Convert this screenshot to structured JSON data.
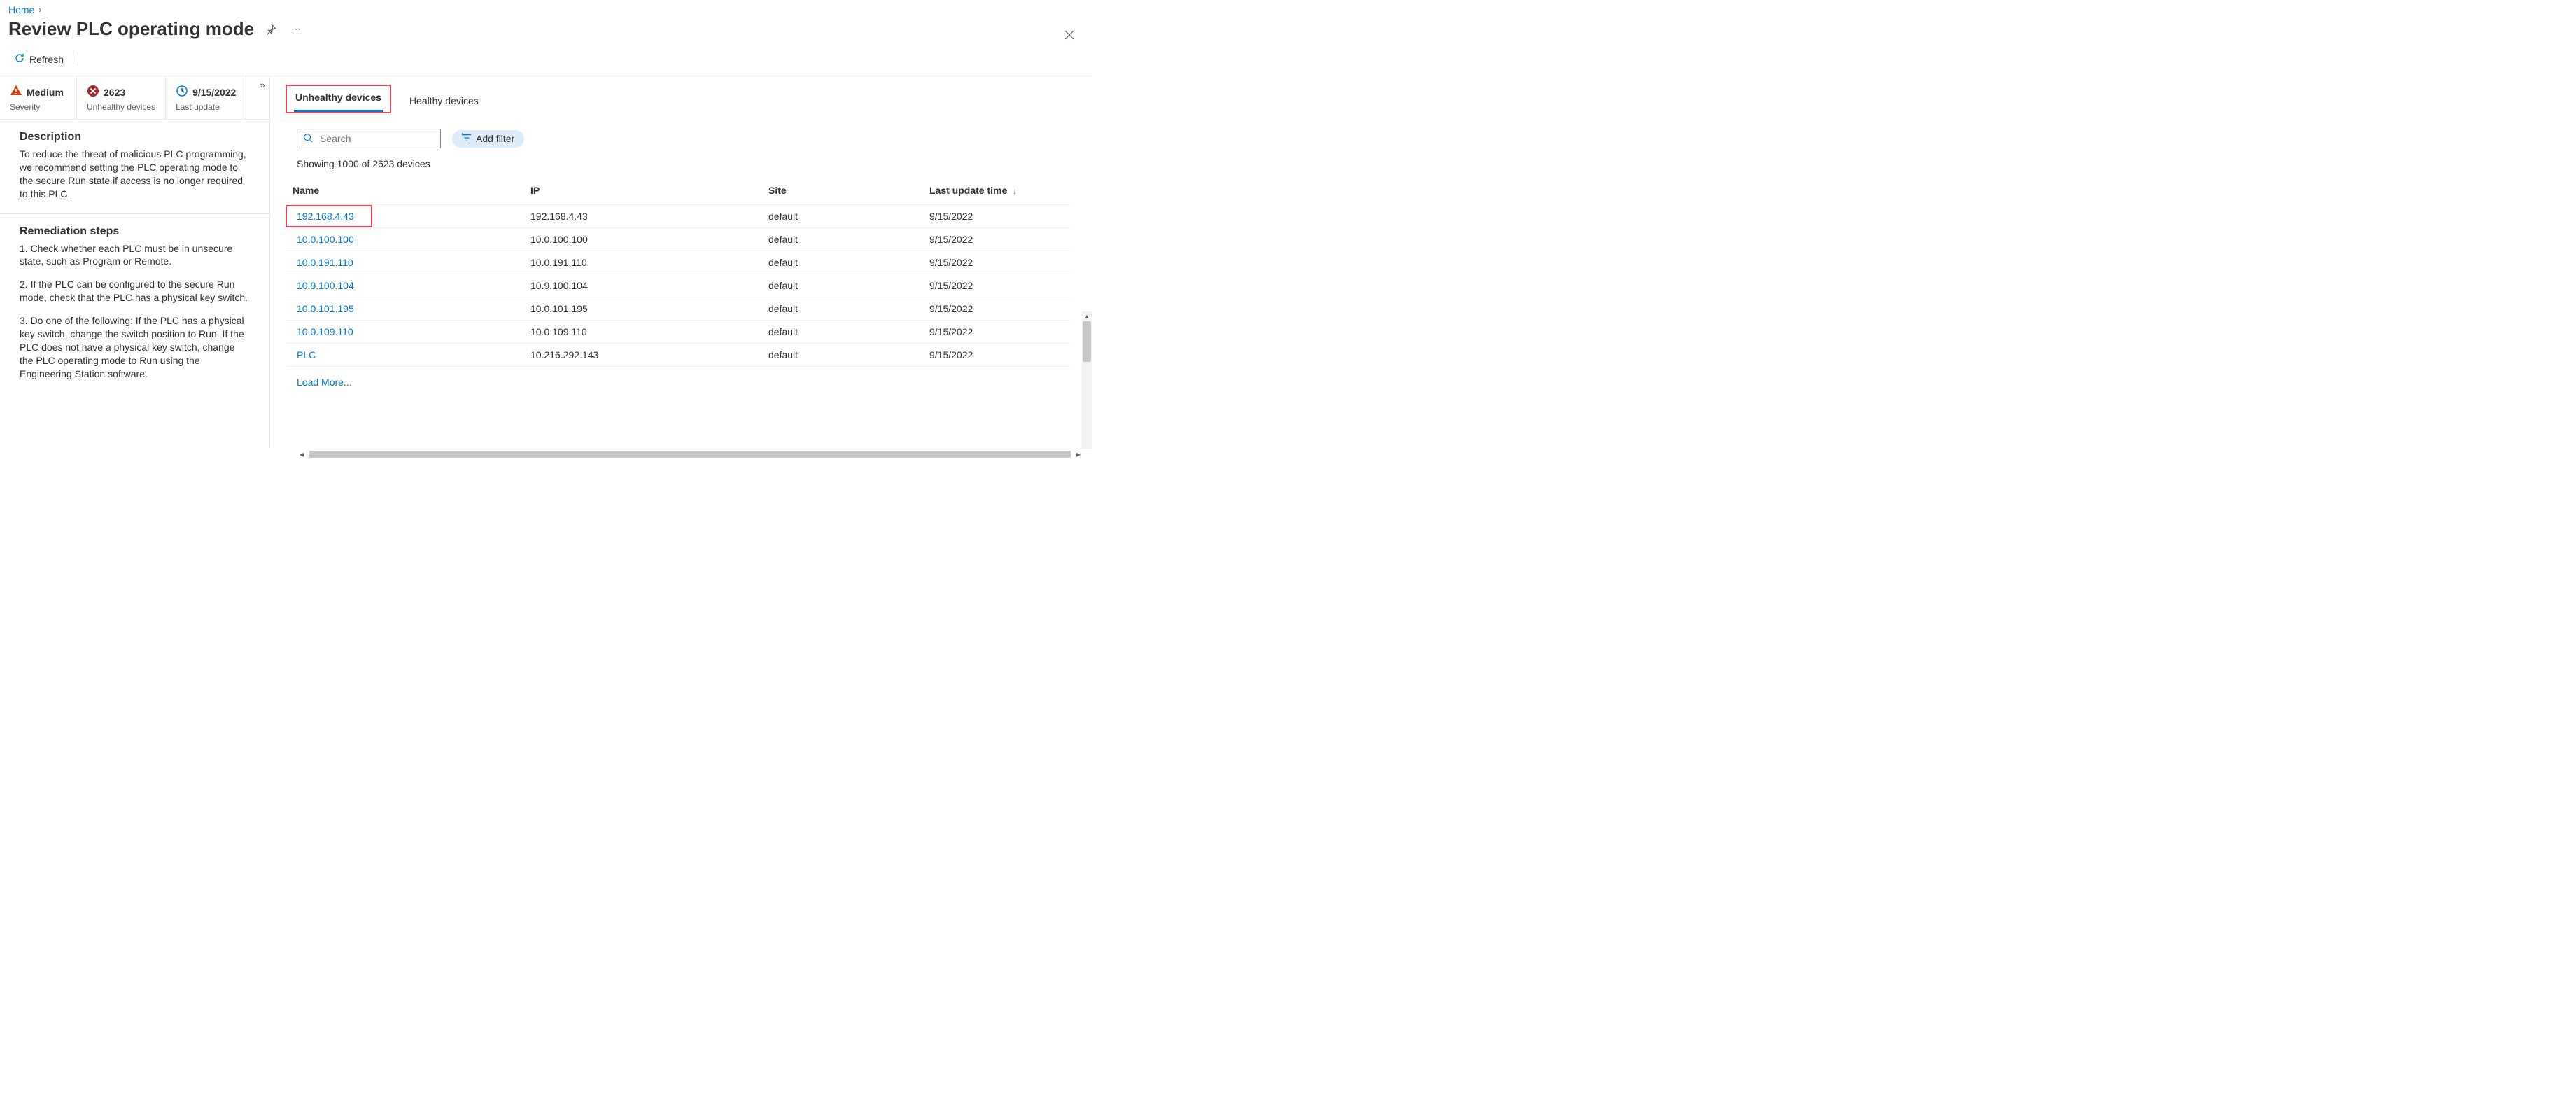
{
  "breadcrumb": {
    "home": "Home"
  },
  "page_title": "Review PLC operating mode",
  "commands": {
    "refresh": "Refresh"
  },
  "close_label": "Close",
  "stats": {
    "severity": {
      "value": "Medium",
      "label": "Severity"
    },
    "unhealthy": {
      "value": "2623",
      "label": "Unhealthy devices"
    },
    "last_update": {
      "value": "9/15/2022",
      "label": "Last update"
    }
  },
  "description": {
    "heading": "Description",
    "body": "To reduce the threat of malicious PLC programming, we recommend setting the PLC operating mode to the secure Run state if access is no longer required to this PLC."
  },
  "remediation": {
    "heading": "Remediation steps",
    "step1": "1. Check whether each PLC must be in unsecure state, such as Program or Remote.",
    "step2": "2. If the PLC can be configured to the secure Run mode, check that the PLC has a physical key switch.",
    "step3": "3. Do one of the following: If the PLC has a physical key switch, change the switch position to Run. If the PLC does not have a physical key switch, change the PLC operating mode to Run using the Engineering Station software."
  },
  "content": {
    "tabs": {
      "unhealthy": "Unhealthy devices",
      "healthy": "Healthy devices"
    },
    "search_placeholder": "Search",
    "add_filter": "Add filter",
    "showing": "Showing 1000 of 2623 devices",
    "columns": {
      "name": "Name",
      "ip": "IP",
      "site": "Site",
      "last_update": "Last update time"
    },
    "rows": [
      {
        "name": "192.168.4.43",
        "ip": "192.168.4.43",
        "site": "default",
        "last_update": "9/15/2022",
        "highlight": true
      },
      {
        "name": "10.0.100.100",
        "ip": "10.0.100.100",
        "site": "default",
        "last_update": "9/15/2022"
      },
      {
        "name": "10.0.191.110",
        "ip": "10.0.191.110",
        "site": "default",
        "last_update": "9/15/2022"
      },
      {
        "name": "10.9.100.104",
        "ip": "10.9.100.104",
        "site": "default",
        "last_update": "9/15/2022"
      },
      {
        "name": "10.0.101.195",
        "ip": "10.0.101.195",
        "site": "default",
        "last_update": "9/15/2022"
      },
      {
        "name": "10.0.109.110",
        "ip": "10.0.109.110",
        "site": "default",
        "last_update": "9/15/2022"
      },
      {
        "name": "PLC",
        "ip": "10.216.292.143",
        "site": "default",
        "last_update": "9/15/2022"
      }
    ],
    "load_more": "Load More..."
  }
}
